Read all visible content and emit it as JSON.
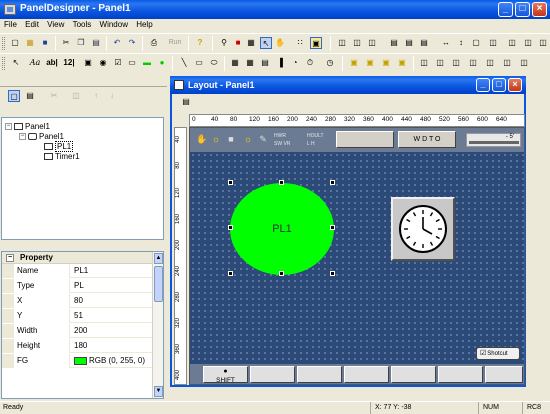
{
  "app": {
    "title": "PanelDesigner - Panel1"
  },
  "menu": [
    "File",
    "Edit",
    "View",
    "Tools",
    "Window",
    "Help"
  ],
  "toolbar1": {
    "run_label": "Run"
  },
  "toolbar2": {
    "text_tools": [
      "Aa",
      "ab|",
      "12|"
    ]
  },
  "tree": {
    "root": "Panel1",
    "child": "Panel1",
    "items": [
      "PL1",
      "Timer1"
    ]
  },
  "properties": {
    "header": "Property",
    "rows": [
      {
        "key": "Name",
        "value": "PL1"
      },
      {
        "key": "Type",
        "value": "PL"
      },
      {
        "key": "X",
        "value": "80"
      },
      {
        "key": "Y",
        "value": "51"
      },
      {
        "key": "Width",
        "value": "200"
      },
      {
        "key": "Height",
        "value": "180"
      },
      {
        "key": "FG",
        "value": "RGB (0, 255, 0)"
      }
    ],
    "fg_color": "#00ff00"
  },
  "layout_window": {
    "title": "Layout - Panel1",
    "ruler_h": [
      "0",
      "40",
      "80",
      "120",
      "160",
      "200",
      "240",
      "280",
      "320",
      "360",
      "400",
      "440",
      "480",
      "520",
      "560",
      "600",
      "640"
    ],
    "ruler_v": [
      "40",
      "80",
      "120",
      "160",
      "200",
      "240",
      "280",
      "320",
      "360",
      "400"
    ],
    "strip_labels": {
      "wdt": "W D T O",
      "slider_value": "- 5'",
      "small1": "HWR",
      "small2": "HOULT",
      "small3": "SW VR",
      "small4": "L H"
    },
    "circle_label": "PL1",
    "shotcut_label": "Shotcut",
    "fkeys": [
      "SHIFT",
      "",
      "",
      "",
      "",
      "",
      "",
      ""
    ]
  },
  "status": {
    "ready": "Ready",
    "coords": "X:    77 Y:  -38",
    "num": "NUM",
    "rc": "RC8"
  }
}
